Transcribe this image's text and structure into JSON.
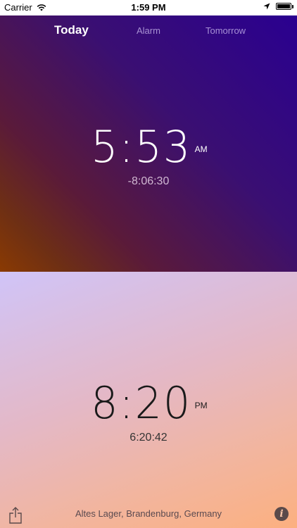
{
  "status_bar": {
    "carrier": "Carrier",
    "time": "1:59 PM",
    "icons": [
      "wifi-icon",
      "location-arrow-icon",
      "battery-icon"
    ]
  },
  "tabs": [
    {
      "label": "Today",
      "active": true
    },
    {
      "label": "Alarm",
      "active": false
    },
    {
      "label": "Tomorrow",
      "active": false
    }
  ],
  "sunrise": {
    "time": "5:53",
    "period": "AM",
    "offset": "-8:06:30"
  },
  "sunset": {
    "time": "8:20",
    "period": "PM",
    "remaining": "6:20:42"
  },
  "footer": {
    "location": "Altes Lager, Brandenburg, Germany",
    "icons": [
      "share-icon",
      "info-icon"
    ]
  },
  "colors": {
    "top_gradient_start": "#2a0090",
    "top_gradient_end": "#8a3a02",
    "bottom_gradient_start": "#d0c4f8",
    "bottom_gradient_end": "#fcb080"
  }
}
